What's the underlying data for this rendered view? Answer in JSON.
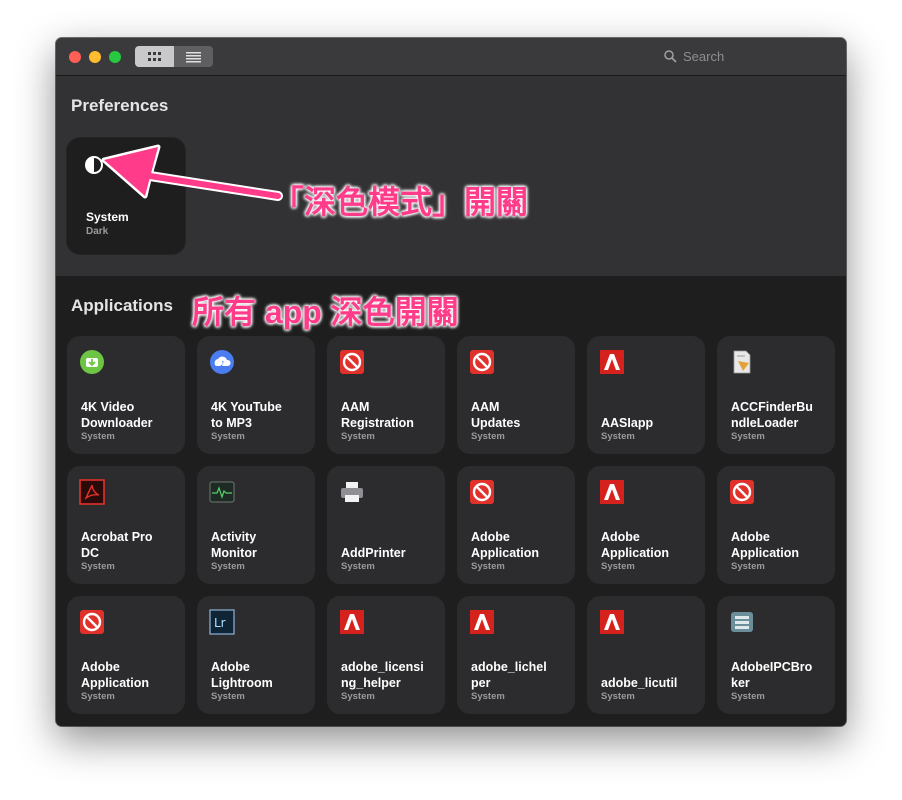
{
  "window": {
    "search_placeholder": "Search"
  },
  "toolbar": {
    "grid_view_icon": "grid-icon",
    "list_view_icon": "list-icon"
  },
  "preferences": {
    "title": "Preferences",
    "tile": {
      "name": "System",
      "value": "Dark",
      "icon": "half-circle-icon"
    }
  },
  "applications": {
    "title": "Applications",
    "items": [
      {
        "label": "4K Video\nDownloader",
        "sub": "System",
        "icon": "green-download"
      },
      {
        "label": "4K YouTube\nto MP3",
        "sub": "System",
        "icon": "blue-cloud"
      },
      {
        "label": "AAM\nRegistration",
        "sub": "System",
        "icon": "noentry"
      },
      {
        "label": "AAM\nUpdates",
        "sub": "System",
        "icon": "noentry"
      },
      {
        "label": "AASIapp",
        "sub": "System",
        "icon": "adobe"
      },
      {
        "label": "ACCFinderBu\nndleLoader",
        "sub": "System",
        "icon": "doc"
      },
      {
        "label": "Acrobat Pro\nDC",
        "sub": "System",
        "icon": "acrobat"
      },
      {
        "label": "Activity\nMonitor",
        "sub": "System",
        "icon": "monitor"
      },
      {
        "label": "AddPrinter",
        "sub": "System",
        "icon": "printer"
      },
      {
        "label": "Adobe\nApplication",
        "sub": "System",
        "icon": "noentry"
      },
      {
        "label": "Adobe\nApplication",
        "sub": "System",
        "icon": "adobe"
      },
      {
        "label": "Adobe\nApplication",
        "sub": "System",
        "icon": "noentry"
      },
      {
        "label": "Adobe\nApplication",
        "sub": "System",
        "icon": "noentry"
      },
      {
        "label": "Adobe\nLightroom",
        "sub": "System",
        "icon": "lightroom"
      },
      {
        "label": "adobe_licensi\nng_helper",
        "sub": "System",
        "icon": "adobe"
      },
      {
        "label": "adobe_lichel\nper",
        "sub": "System",
        "icon": "adobe"
      },
      {
        "label": "adobe_licutil",
        "sub": "System",
        "icon": "adobe"
      },
      {
        "label": "AdobeIPCBro\nker",
        "sub": "System",
        "icon": "ipc"
      }
    ]
  },
  "annotations": {
    "dark_mode_switch": "「深色模式」開關",
    "all_apps_dark": "所有 app 深色開關",
    "color": "#ff3b8a"
  }
}
